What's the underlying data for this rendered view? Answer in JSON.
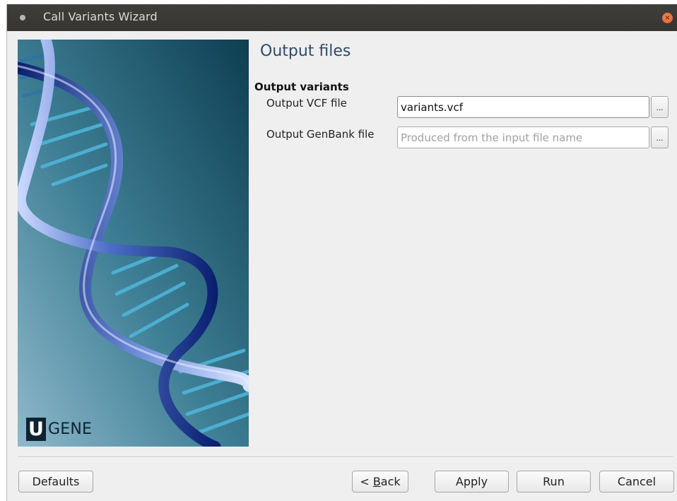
{
  "window": {
    "title": "Call Variants Wizard",
    "close_glyph": "×"
  },
  "banner": {
    "logo_letter": "U",
    "logo_text": "GENE"
  },
  "page": {
    "title": "Output files",
    "group_title": "Output variants",
    "fields": [
      {
        "label": "Output VCF file",
        "value": "variants.vcf",
        "placeholder": "",
        "browse_label": "..."
      },
      {
        "label": "Output GenBank file",
        "value": "",
        "placeholder": "Produced from the input file name",
        "browse_label": "..."
      }
    ]
  },
  "footer": {
    "defaults_label": "Defaults",
    "back_prefix": "< ",
    "back_mnemonic": "B",
    "back_rest": "ack",
    "apply_label": "Apply",
    "run_label": "Run",
    "cancel_label": "Cancel"
  },
  "colors": {
    "titlebar": "#3c3b37",
    "close_button": "#e9622f",
    "page_title": "#2b4c6b",
    "window_bg": "#efefef"
  },
  "icons": {
    "window_menu": "dot-icon",
    "close": "close-icon",
    "browse": "ellipsis-icon"
  }
}
